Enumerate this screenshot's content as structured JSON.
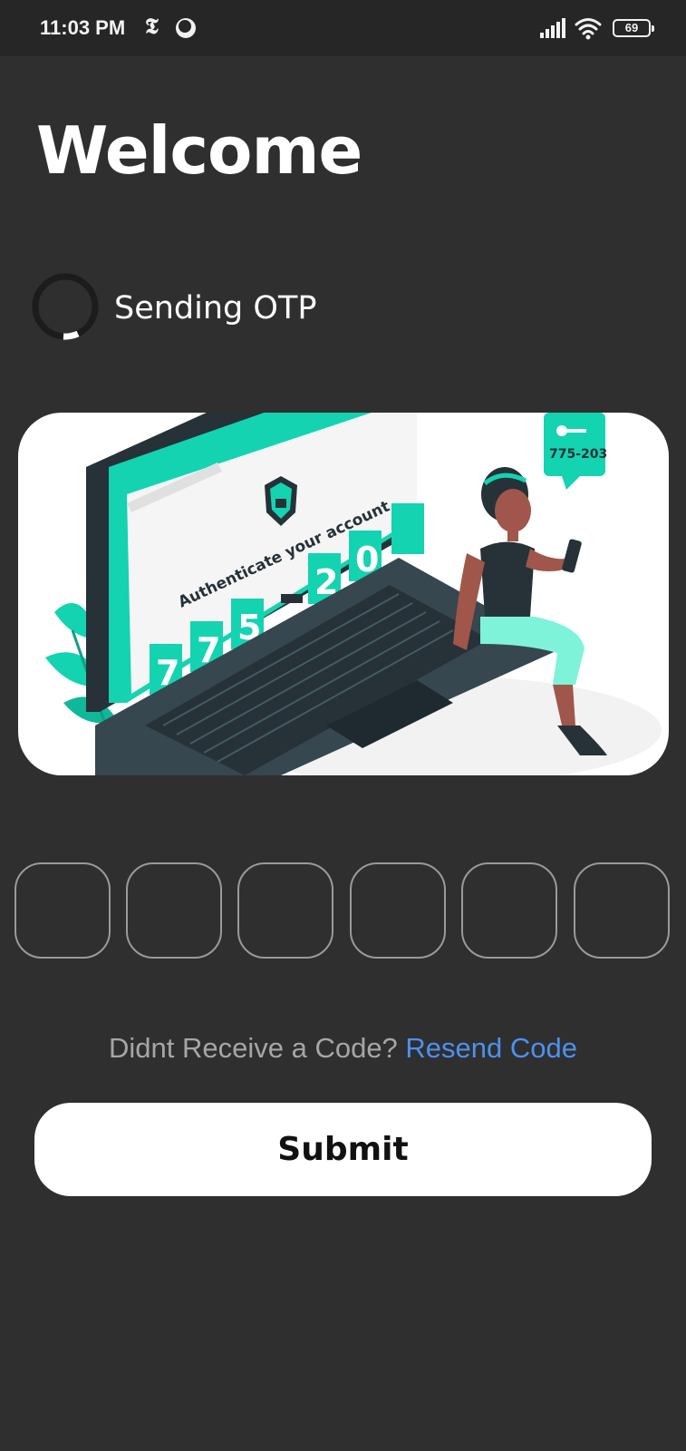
{
  "status_bar": {
    "time": "11:03 PM",
    "battery": "69",
    "icons": [
      "nyt-icon",
      "moon-icon",
      "signal-icon",
      "wifi-icon",
      "battery-icon"
    ]
  },
  "page": {
    "title": "Welcome",
    "loading_text": "Sending OTP"
  },
  "illustration": {
    "browser_text": "Authenticate your account",
    "code_digits": [
      "7",
      "7",
      "5",
      "-",
      "2",
      "0"
    ],
    "bubble_code": "775-203",
    "colors": {
      "accent": "#14d3b1",
      "dark": "#263238",
      "skin": "#a0564a"
    }
  },
  "otp": {
    "boxes": [
      "",
      "",
      "",
      "",
      "",
      ""
    ]
  },
  "resend": {
    "question": "Didnt Receive a Code?",
    "link": "Resend Code"
  },
  "actions": {
    "submit_label": "Submit"
  },
  "colors": {
    "background": "#2f2f2f",
    "status_bar": "#262626",
    "link": "#4d90f0",
    "box_border": "#9a9a9a"
  }
}
